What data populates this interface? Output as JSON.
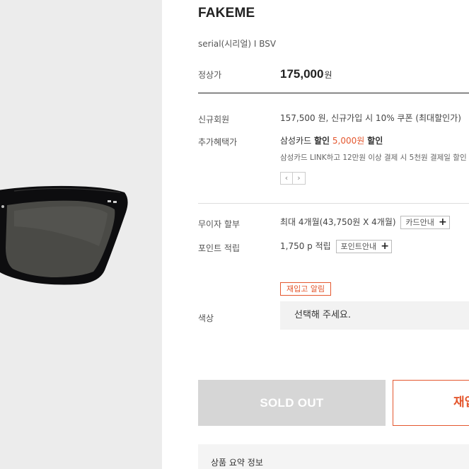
{
  "product": {
    "brand": "FAKEME",
    "serial": "serial(시리얼) I BSV",
    "price_label": "정상가",
    "price": "175,000",
    "price_unit": "원"
  },
  "benefits": {
    "new_member_label": "신규회원",
    "new_member_value": "157,500 원, 신규가입 시 10% 쿠폰 (최대할인가)",
    "extra_label": "추가혜택가",
    "extra_card": "삼성카드",
    "extra_discount_word": "할인",
    "extra_amount": "5,000원",
    "extra_discount_word2": "할인",
    "extra_sub": "삼성카드 LINK하고 12만원 이상 결제 시 5천원 결제일 할인",
    "prev_arrow": "‹",
    "next_arrow": "›"
  },
  "installment": {
    "label": "무이자 할부",
    "value": "최대 4개월(43,750원 X 4개월)",
    "card_info_button": "카드안내",
    "plus": "+"
  },
  "points": {
    "label": "포인트 적립",
    "amount": "1,750 p",
    "word": "적립",
    "info_button": "포인트안내",
    "plus": "+"
  },
  "restock_tag": "재입고 알림",
  "color": {
    "label": "색상",
    "placeholder": "선택해 주세요."
  },
  "buttons": {
    "sold_out": "SOLD OUT",
    "restock": "재입"
  },
  "summary": {
    "label": "상품 요약 정보"
  },
  "colors": {
    "accent": "#e4572e",
    "sold_out_bg": "#d6d6d6",
    "gallery_bg": "#ececec"
  }
}
